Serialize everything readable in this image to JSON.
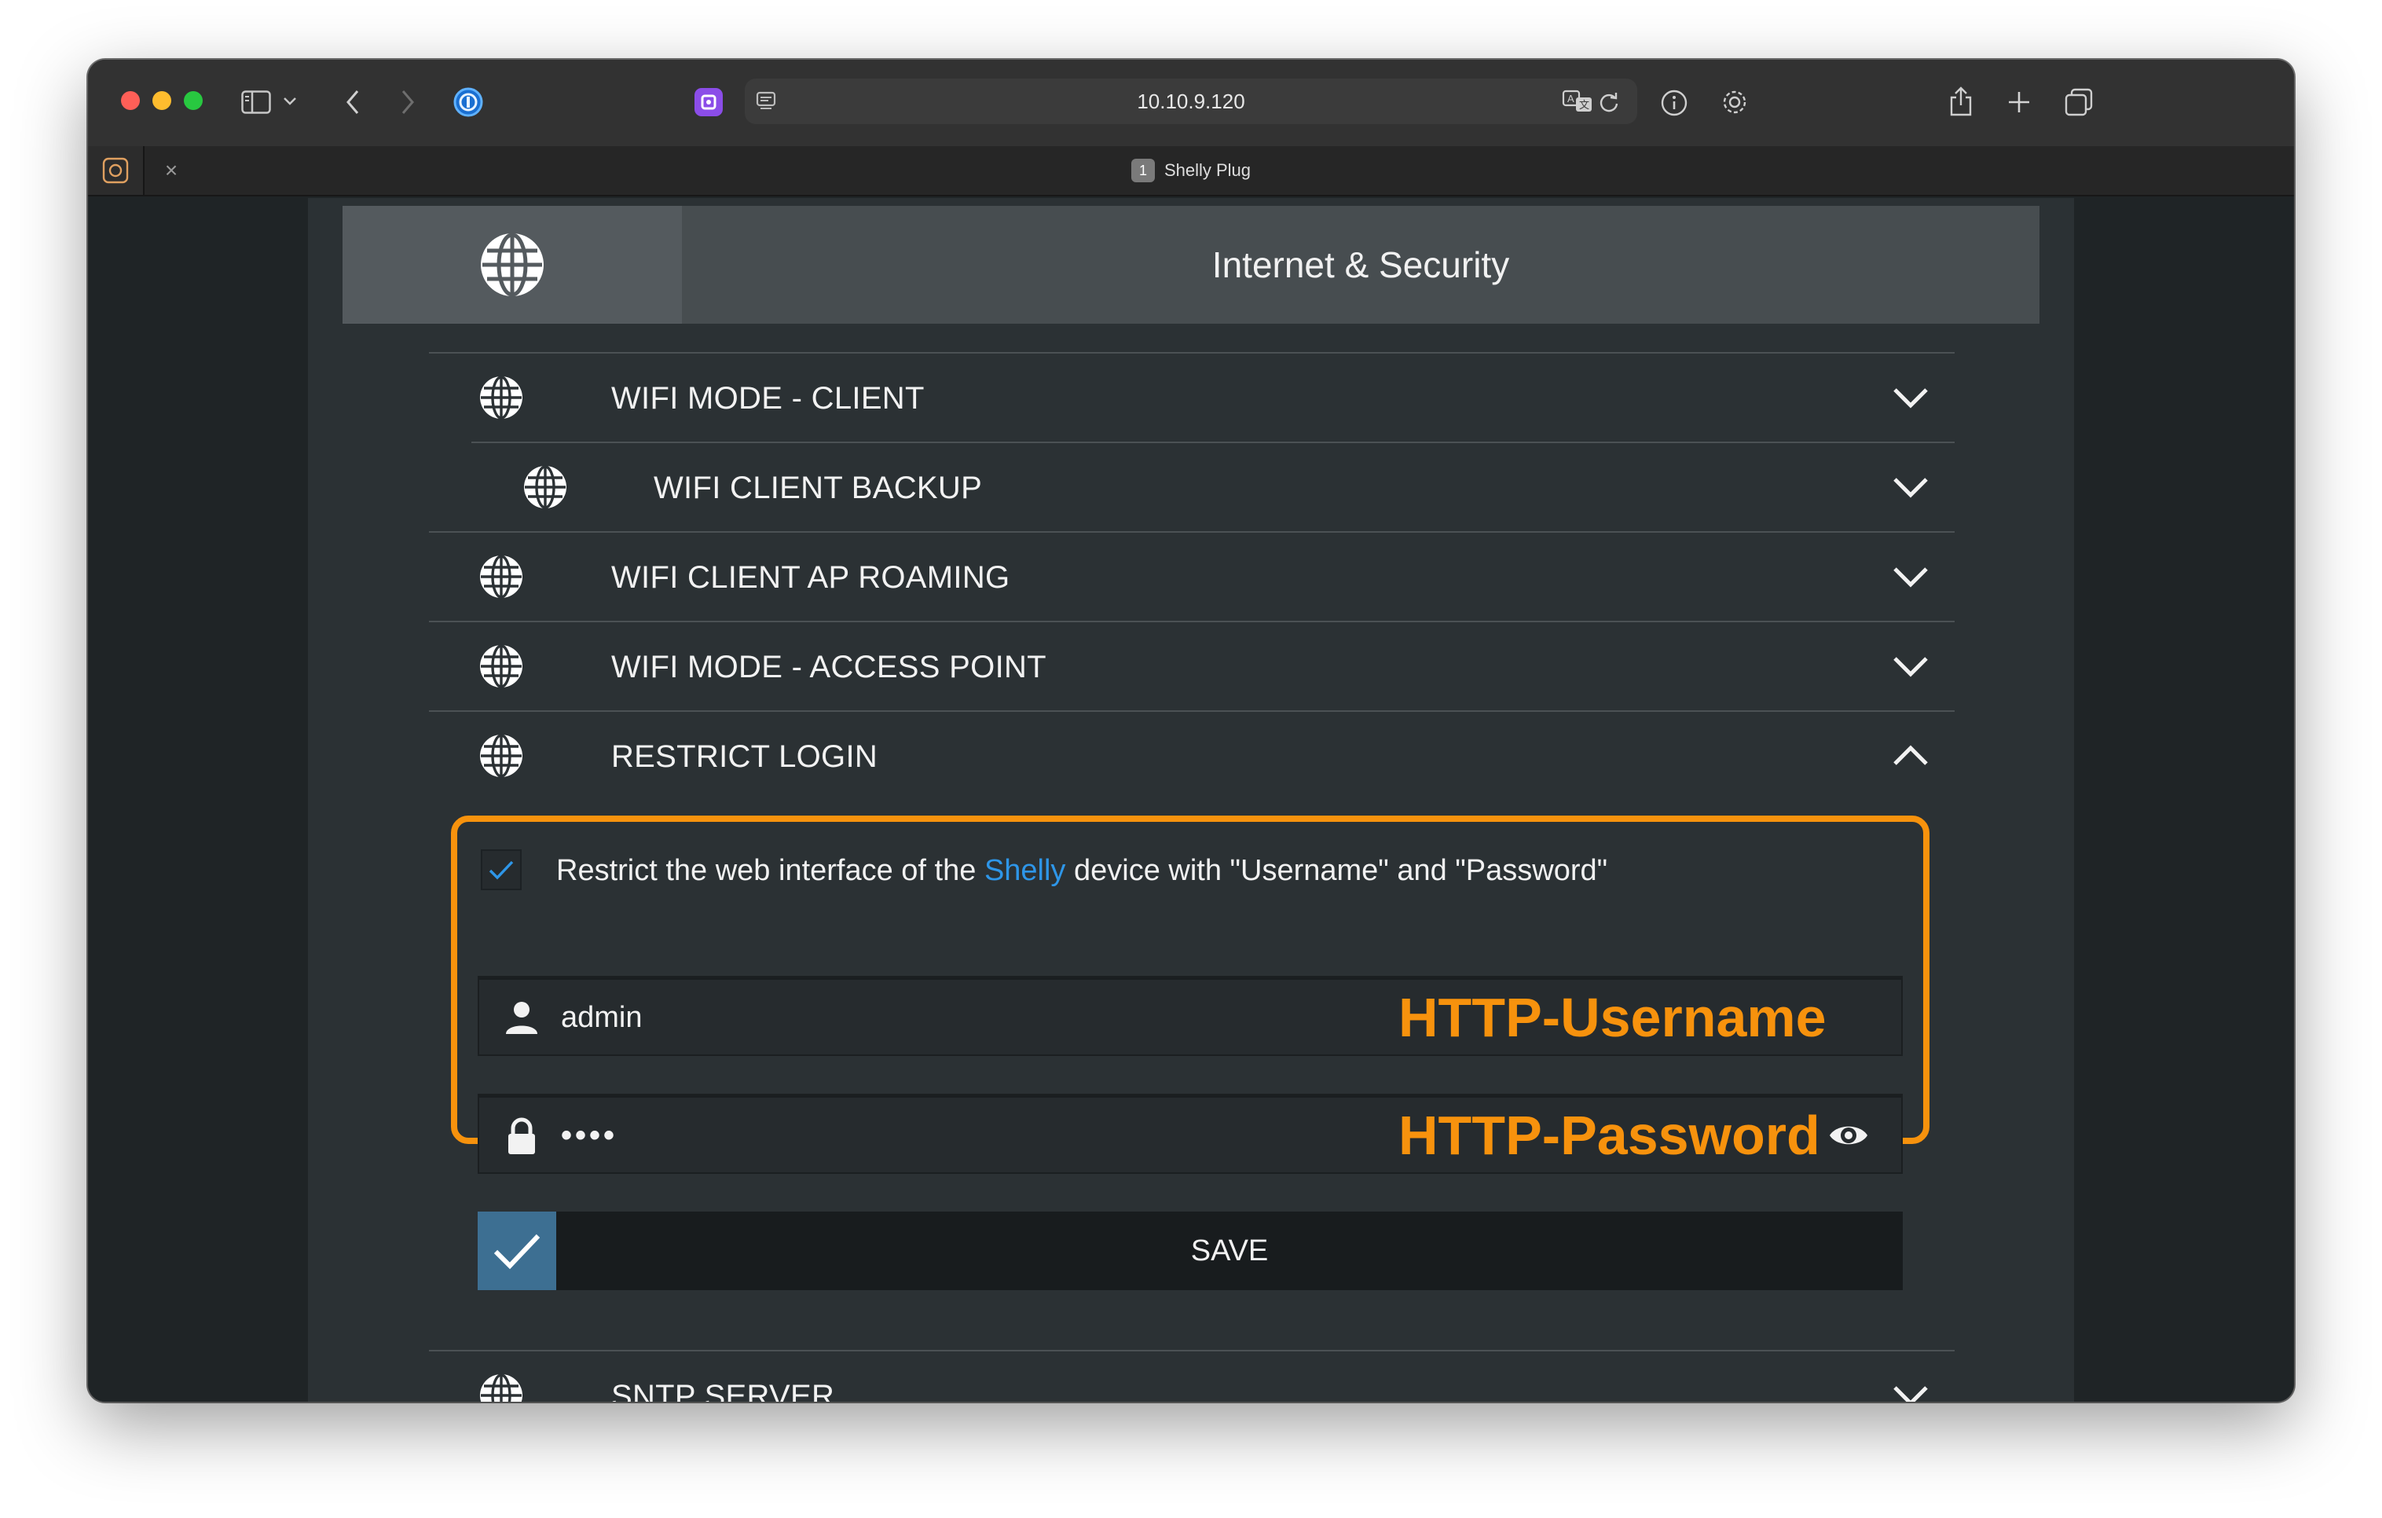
{
  "browser": {
    "address": "10.10.9.120",
    "tab": {
      "index": "1",
      "title": "Shelly Plug",
      "close_glyph": "×"
    },
    "icons": [
      "sidebar-icon",
      "chevron-down-icon",
      "back-icon",
      "forward-icon",
      "password-manager-icon",
      "extension-icon",
      "page-menu-icon",
      "translate-icon",
      "reload-icon",
      "info-icon",
      "settings-icon",
      "share-icon",
      "new-tab-icon",
      "tab-overview-icon"
    ]
  },
  "header": {
    "title": "Internet & Security",
    "icon": "globe-icon"
  },
  "accordion": [
    {
      "label": "WIFI MODE - CLIENT",
      "state": "collapsed"
    },
    {
      "label": "WIFI CLIENT BACKUP",
      "state": "collapsed"
    },
    {
      "label": "WIFI CLIENT AP ROAMING",
      "state": "collapsed"
    },
    {
      "label": "WIFI MODE - ACCESS POINT",
      "state": "collapsed"
    },
    {
      "label": "RESTRICT LOGIN",
      "state": "expanded"
    },
    {
      "label": "SNTP SERVER",
      "state": "collapsed"
    }
  ],
  "restrict_login": {
    "checked": true,
    "text_before": "Restrict the web interface of the ",
    "text_link": "Shelly",
    "text_after": " device with \"Username\" and \"Password\"",
    "username_value": "admin",
    "password_value": "••••",
    "username_annotation": "HTTP-Username",
    "password_annotation": "HTTP-Password",
    "save_label": "SAVE"
  },
  "colors": {
    "accent_orange": "#f7920d",
    "link_blue": "#2e96e8",
    "save_check_bg": "#3d6f92",
    "page_bg": "#2b3134"
  }
}
